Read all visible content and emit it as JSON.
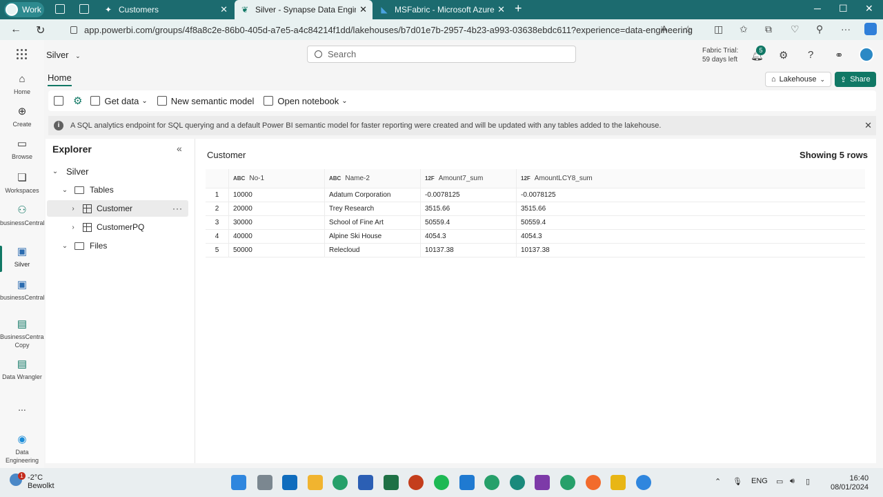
{
  "browser": {
    "profile": "Work",
    "tabs": [
      {
        "title": "Customers"
      },
      {
        "title": "Silver - Synapse Data Engineering"
      },
      {
        "title": "MSFabric - Microsoft Azure"
      }
    ],
    "url": "app.powerbi.com/groups/4f8a8c2e-86b0-405d-a7e5-a4c84214f1dd/lakehouses/b7d01e7b-2957-4b23-a993-03638ebdc611?experience=data-engineering"
  },
  "rail": {
    "items": [
      {
        "label": "Home",
        "icon": "home-icon"
      },
      {
        "label": "Create",
        "icon": "plus-circle-icon"
      },
      {
        "label": "Browse",
        "icon": "folder-icon"
      },
      {
        "label": "Workspaces",
        "icon": "workspaces-icon"
      },
      {
        "label": "businessCentral",
        "icon": "people-icon"
      },
      {
        "label": "Silver",
        "icon": "lakehouse-icon"
      },
      {
        "label": "businessCentral",
        "icon": "lakehouse-icon"
      },
      {
        "label": "BusinessCentral Copy",
        "icon": "notebook-icon"
      },
      {
        "label": "Data Wrangler",
        "icon": "notebook-icon"
      },
      {
        "label": "Data Engineering",
        "icon": "data-engineering-icon"
      }
    ],
    "more": "..."
  },
  "topbar": {
    "workspace": "Silver",
    "search_placeholder": "Search",
    "trial_line1": "Fabric Trial:",
    "trial_line2": "59 days left",
    "notif_count": "5"
  },
  "ribbon": {
    "home_tab": "Home",
    "lakehouse_btn": "Lakehouse",
    "share_btn": "Share",
    "get_data": "Get data",
    "new_semantic_model": "New semantic model",
    "open_notebook": "Open notebook"
  },
  "banner": {
    "text": "A SQL analytics endpoint for SQL querying and a default Power BI semantic model for faster reporting were created and will be updated with any tables added to the lakehouse."
  },
  "explorer": {
    "title": "Explorer",
    "root": "Silver",
    "tables_folder": "Tables",
    "tables": [
      "Customer",
      "CustomerPQ"
    ],
    "files_folder": "Files"
  },
  "datapane": {
    "table_name": "Customer",
    "showing": "Showing 5 rows",
    "columns": [
      {
        "type": "ABC",
        "name": "No-1"
      },
      {
        "type": "ABC",
        "name": "Name-2"
      },
      {
        "type": "12F",
        "name": "Amount7_sum"
      },
      {
        "type": "12F",
        "name": "AmountLCY8_sum"
      }
    ],
    "rows": [
      [
        "1",
        "10000",
        "Adatum Corporation",
        "-0.0078125",
        "-0.0078125"
      ],
      [
        "2",
        "20000",
        "Trey Research",
        "3515.66",
        "3515.66"
      ],
      [
        "3",
        "30000",
        "School of Fine Art",
        "50559.4",
        "50559.4"
      ],
      [
        "4",
        "40000",
        "Alpine Ski House",
        "4054.3",
        "4054.3"
      ],
      [
        "5",
        "50000",
        "Relecloud",
        "10137.38",
        "10137.38"
      ]
    ]
  },
  "taskbar": {
    "temp": "-2°C",
    "weather": "Bewolkt",
    "weather_badge": "1",
    "lang": "ENG",
    "time": "16:40",
    "date": "08/01/2024"
  }
}
